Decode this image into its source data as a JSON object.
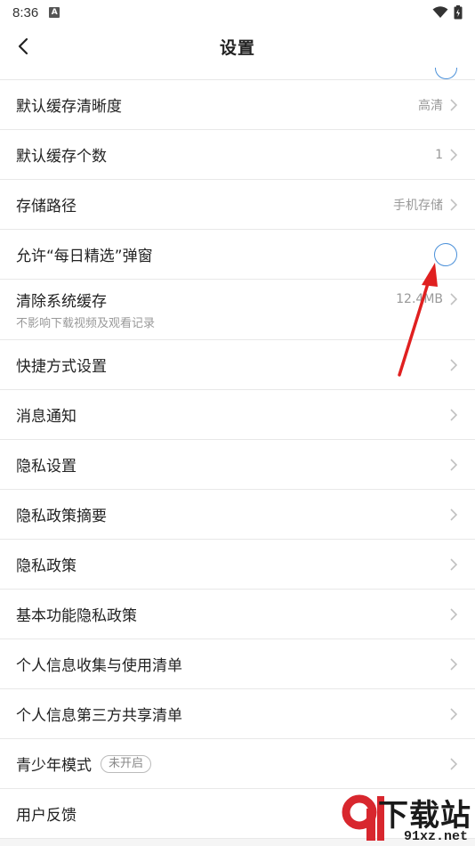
{
  "status_bar": {
    "time": "8:36",
    "notification_badge": "A"
  },
  "nav": {
    "title": "设置"
  },
  "rows": [
    {
      "label": "默认缓存清晰度",
      "value": "高清"
    },
    {
      "label": "默认缓存个数",
      "value": "1"
    },
    {
      "label": "存储路径",
      "value": "手机存储"
    },
    {
      "label": "允许“每日精选”弹窗",
      "toggle": "off"
    },
    {
      "label": "清除系统缓存",
      "sublabel": "不影响下载视频及观看记录",
      "value": "12.4MB"
    },
    {
      "label": "快捷方式设置"
    },
    {
      "label": "消息通知"
    },
    {
      "label": "隐私设置"
    },
    {
      "label": "隐私政策摘要"
    },
    {
      "label": "隐私政策"
    },
    {
      "label": "基本功能隐私政策"
    },
    {
      "label": "个人信息收集与使用清单"
    },
    {
      "label": "个人信息第三方共享清单"
    },
    {
      "label": "青少年模式",
      "badge": "未开启"
    },
    {
      "label": "用户反馈"
    }
  ],
  "watermark": {
    "text": "下载站",
    "url": "91xz.net"
  },
  "colors": {
    "toggle_border": "#4a90d9",
    "arrow": "#e02020",
    "chevron": "#c0c0c0"
  }
}
